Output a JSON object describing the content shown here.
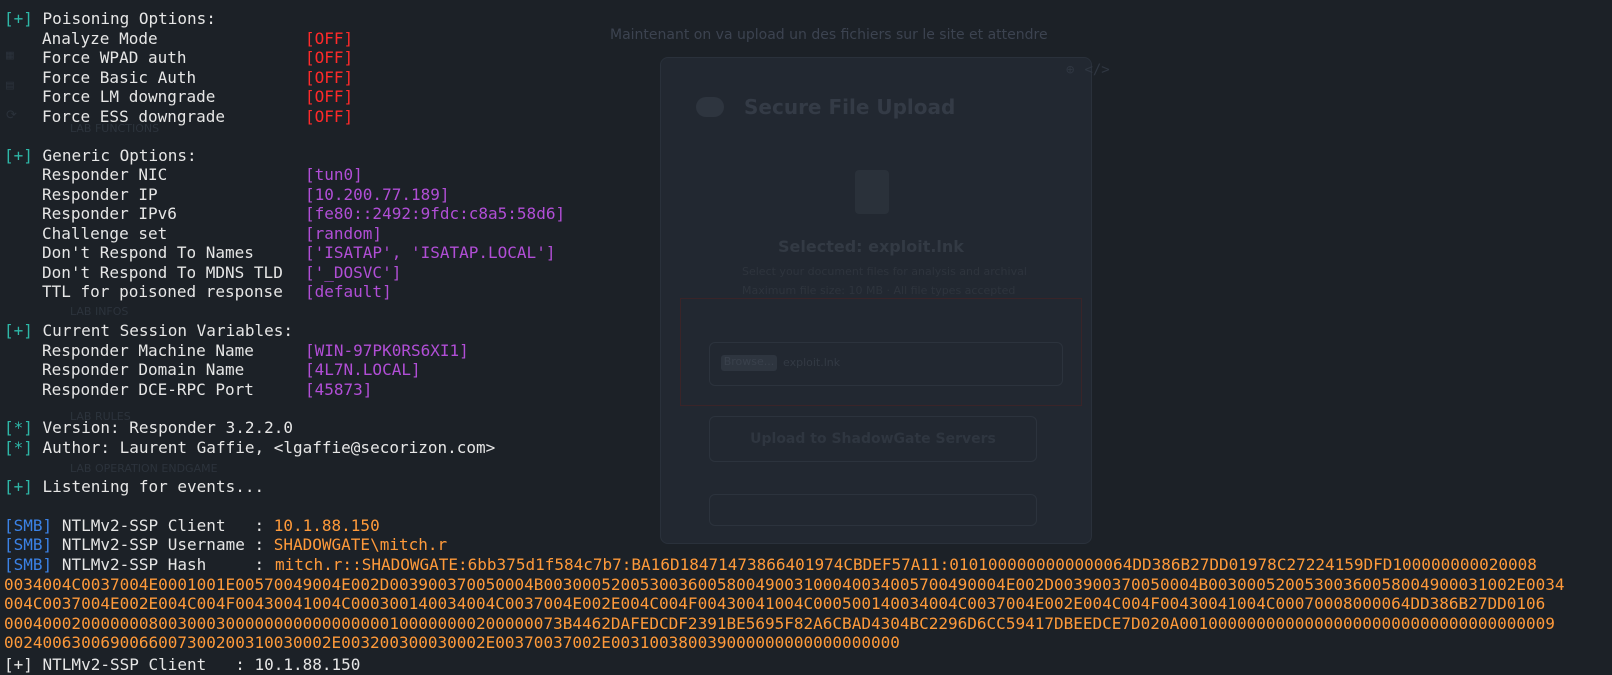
{
  "background_page": {
    "caption": "Maintenant on va upload un des fichiers sur le site et attendre",
    "card_title": "Secure File Upload",
    "selected": "Selected: exploit.lnk",
    "note_1": "Select your document files for analysis and archival",
    "note_2": "Maximum file size: 10 MB · All file types accepted",
    "browse_label": "Browse...",
    "file_name": "exploit.lnk",
    "upload_button": "Upload to ShadowGate Servers",
    "sidebar_labels": [
      "LAB FUNCTIONS",
      "LAB INFOS",
      "LAB RULES",
      "LAB OPERATION ENDGAME"
    ]
  },
  "terminal": {
    "colors": {
      "bracket": "#2eb8a8",
      "smb": "#3b82e6",
      "off": "#ff2a2a",
      "value": "#b14ed6",
      "capture": "#ff9a3a"
    },
    "poisoning": {
      "header": "Poisoning Options:",
      "rows": [
        {
          "label": "Analyze Mode",
          "value": "[OFF]"
        },
        {
          "label": "Force WPAD auth",
          "value": "[OFF]"
        },
        {
          "label": "Force Basic Auth",
          "value": "[OFF]"
        },
        {
          "label": "Force LM downgrade",
          "value": "[OFF]"
        },
        {
          "label": "Force ESS downgrade",
          "value": "[OFF]"
        }
      ]
    },
    "generic": {
      "header": "Generic Options:",
      "rows": [
        {
          "label": "Responder NIC",
          "value": "[tun0]"
        },
        {
          "label": "Responder IP",
          "value": "[10.200.77.189]"
        },
        {
          "label": "Responder IPv6",
          "value": "[fe80::2492:9fdc:c8a5:58d6]"
        },
        {
          "label": "Challenge set",
          "value": "[random]"
        },
        {
          "label": "Don't Respond To Names",
          "value": "['ISATAP', 'ISATAP.LOCAL']"
        },
        {
          "label": "Don't Respond To MDNS TLD",
          "value": "['_DOSVC']"
        },
        {
          "label": "TTL for poisoned response",
          "value": "[default]"
        }
      ]
    },
    "session": {
      "header": "Current Session Variables:",
      "rows": [
        {
          "label": "Responder Machine Name",
          "value": "[WIN-97PK0RS6XI1]"
        },
        {
          "label": "Responder Domain Name",
          "value": "[4L7N.LOCAL]"
        },
        {
          "label": "Responder DCE-RPC Port",
          "value": "[45873]"
        }
      ]
    },
    "version": "Version: Responder 3.2.2.0",
    "author": "Author: Laurent Gaffie, <lgaffie@secorizon.com>",
    "listening": "Listening for events...",
    "prefix_plus": "[+]",
    "prefix_star": "[*]",
    "prefix_smb": "[SMB]",
    "smb": {
      "client_label": "NTLMv2-SSP Client   : ",
      "client_value": "10.1.88.150",
      "username_label": "NTLMv2-SSP Username : ",
      "username_value": "SHADOWGATE\\mitch.r",
      "hash_label": "NTLMv2-SSP Hash     : ",
      "hash_lines": [
        "mitch.r::SHADOWGATE:6bb375d1f584c7b7:BA16D18471473866401974CBDEF57A11:0101000000000000064DD386B27DD01978C27224159DFD100000000020008",
        "0034004C0037004E0001001E00570049004E002D003900370050004B003000520053003600580049003100040034005700490004E002D003900370050004B00300052005300360058004900031002E0034",
        "004C0037004E002E004C004F00430041004C000300140034004C0037004E002E004C004F00430041004C000500140034004C0037004E002E004C004F00430041004C00070008000064DD386B27DD0106",
        "0004000200000008003000300000000000000000100000000200000073B4462DAFEDCDF2391BE5695F82A6CBAD4304BC2296D6CC59417DBEEDCE7D020A001000000000000000000000000000000000009",
        "0024006300690066007300200310030002E003200300030002E00370037002E003100380039000000000000000000"
      ]
    },
    "cut_line": "[+] NTLMv2-SSP Client   : 10.1.88.150"
  }
}
